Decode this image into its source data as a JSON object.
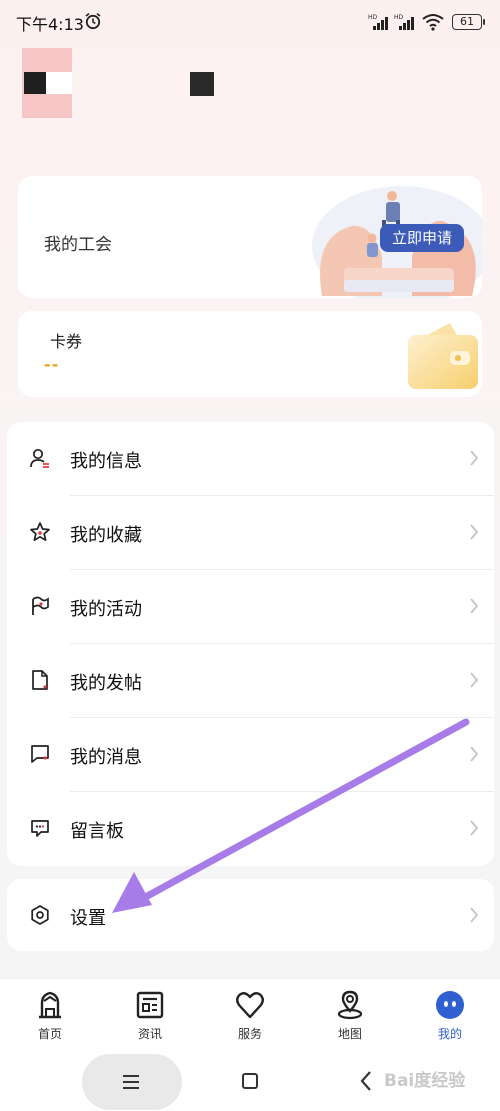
{
  "status_bar": {
    "time": "下午4:13",
    "battery": "61",
    "icons": [
      "alarm-icon",
      "signal-hd-icon",
      "signal-hd-icon",
      "wifi-icon",
      "battery-icon"
    ]
  },
  "union_card": {
    "title": "我的工会",
    "button_label": "立即申请"
  },
  "coupon_card": {
    "title": "卡券",
    "value": "--"
  },
  "menu": {
    "items": [
      {
        "label": "我的信息",
        "icon": "user-icon"
      },
      {
        "label": "我的收藏",
        "icon": "star-icon"
      },
      {
        "label": "我的活动",
        "icon": "flag-icon"
      },
      {
        "label": "我的发帖",
        "icon": "document-icon"
      },
      {
        "label": "我的消息",
        "icon": "message-icon"
      },
      {
        "label": "留言板",
        "icon": "comment-icon"
      }
    ]
  },
  "settings": {
    "label": "设置",
    "icon": "settings-icon"
  },
  "tab_bar": {
    "tabs": [
      {
        "label": "首页",
        "icon": "home-icon"
      },
      {
        "label": "资讯",
        "icon": "news-icon"
      },
      {
        "label": "服务",
        "icon": "heart-icon"
      },
      {
        "label": "地图",
        "icon": "map-pin-icon"
      },
      {
        "label": "我的",
        "icon": "profile-icon",
        "active": true
      }
    ]
  },
  "system_nav": {
    "watermark": "Bai度经验"
  },
  "colors": {
    "accent": "#3c5ab8",
    "tab_active": "#2f5fd0",
    "coupon_value": "#f0a020",
    "annotation_arrow": "#a77be8"
  }
}
